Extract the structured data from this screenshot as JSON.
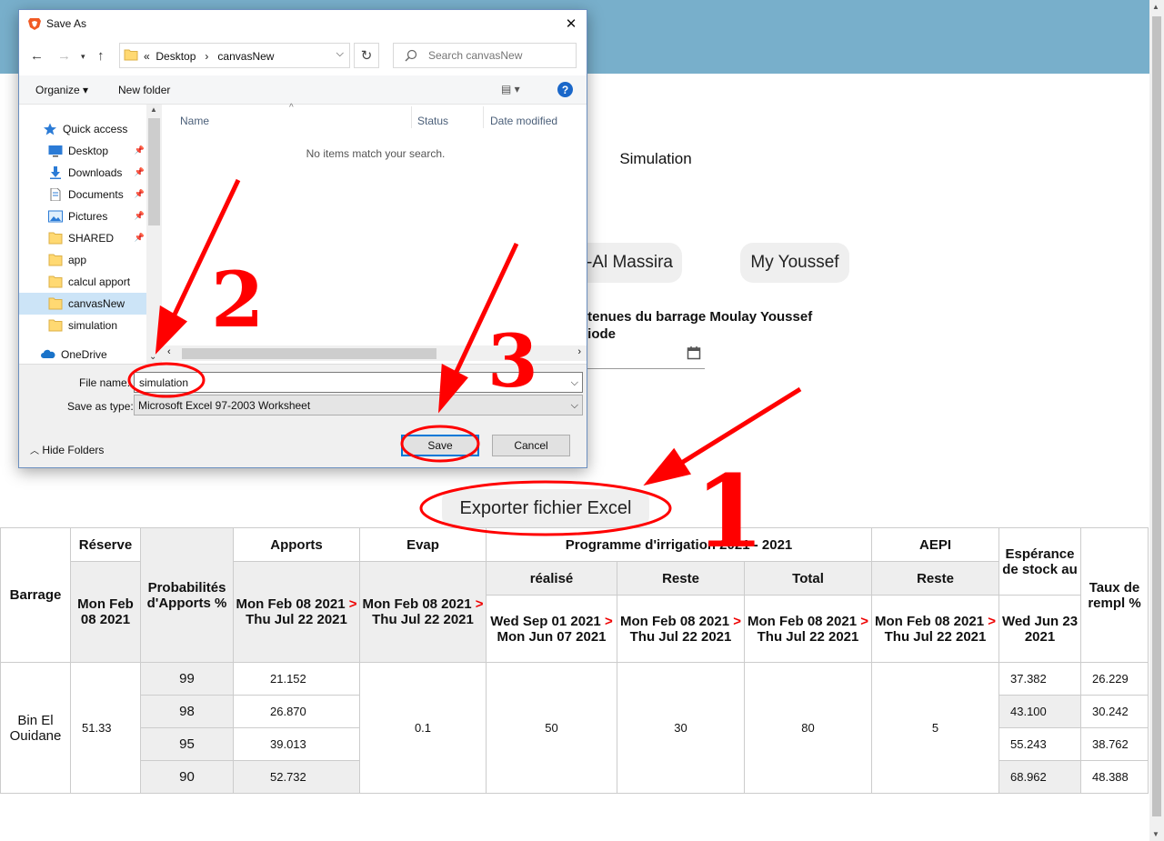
{
  "page": {
    "title": "Simulation",
    "tabs": [
      "-Al Massira",
      "My Youssef"
    ],
    "retenues_label_line1": "retenues du barrage Moulay Youssef",
    "retenues_label_line2": "eriode",
    "export_button": "Exporter fichier Excel"
  },
  "table": {
    "headers": {
      "barrage": "Barrage",
      "reserve": "Réserve",
      "reserve_date": "Mon Feb 08 2021",
      "probabilites": "Probabilités d'Apports %",
      "apports": "Apports",
      "apports_from": "Mon Feb 08 2021",
      "apports_to": "Thu Jul 22 2021",
      "evap": "Evap",
      "evap_from": "Mon Feb 08 2021",
      "evap_to": "Thu Jul 22 2021",
      "programme": "Programme d'irrigation 2021 - 2021",
      "realise": "réalisé",
      "realise_from": "Wed Sep 01 2021",
      "realise_to": "Mon Jun 07 2021",
      "reste": "Reste",
      "reste_from": "Mon Feb 08 2021",
      "reste_to": "Thu Jul 22 2021",
      "total": "Total",
      "total_from": "Mon Feb 08 2021",
      "total_to": "Thu Jul 22 2021",
      "aepi": "AEPI",
      "aepi_reste": "Reste",
      "aepi_from": "Mon Feb 08 2021",
      "aepi_to": "Thu Jul 22 2021",
      "esperance": "Espérance de stock au",
      "esperance_date": "Wed Jun 23 2021",
      "taux": "Taux de rempl %",
      "arrow": ">"
    },
    "barrage_name": "Bin El Ouidane",
    "reserve": "51.33",
    "evap": "0.1",
    "realise": "50",
    "reste": "30",
    "total": "80",
    "aepi": "5",
    "rows": [
      {
        "prob": "99",
        "apports": "21.152",
        "esperance": "37.382",
        "taux": "26.229"
      },
      {
        "prob": "98",
        "apports": "26.870",
        "esperance": "43.100",
        "taux": "30.242"
      },
      {
        "prob": "95",
        "apports": "39.013",
        "esperance": "55.243",
        "taux": "38.762"
      },
      {
        "prob": "90",
        "apports": "52.732",
        "esperance": "68.962",
        "taux": "48.388"
      }
    ]
  },
  "dialog": {
    "title": "Save As",
    "address": [
      "«",
      "Desktop",
      "›",
      "canvasNew"
    ],
    "search_placeholder": "Search canvasNew",
    "organize": "Organize ▾",
    "new_folder": "New folder",
    "help": "?",
    "nav_items": [
      {
        "label": "Quick access",
        "icon": "star-icon"
      },
      {
        "label": "Desktop",
        "icon": "desktop-icon",
        "pinned": true
      },
      {
        "label": "Downloads",
        "icon": "download-icon",
        "pinned": true
      },
      {
        "label": "Documents",
        "icon": "document-icon",
        "pinned": true
      },
      {
        "label": "Pictures",
        "icon": "picture-icon",
        "pinned": true
      },
      {
        "label": "SHARED",
        "icon": "folder-icon",
        "pinned": true
      },
      {
        "label": "app",
        "icon": "folder-icon"
      },
      {
        "label": "calcul apport",
        "icon": "folder-icon"
      },
      {
        "label": "canvasNew",
        "icon": "folder-icon",
        "selected": true
      },
      {
        "label": "simulation",
        "icon": "folder-icon"
      },
      {
        "label": "OneDrive",
        "icon": "cloud-icon"
      }
    ],
    "columns": [
      "Name",
      "Status",
      "Date modified"
    ],
    "empty_message": "No items match your search.",
    "file_name_label": "File name:",
    "file_name_value": "simulation",
    "save_type_label": "Save as type:",
    "save_type_value": "Microsoft Excel 97-2003 Worksheet",
    "hide_folders": "Hide Folders",
    "save": "Save",
    "cancel": "Cancel"
  },
  "annotations": [
    "1",
    "2",
    "3"
  ],
  "colors": {
    "topbar": "#78afcb",
    "annotation": "#ff0000",
    "accent": "#0078d7"
  }
}
